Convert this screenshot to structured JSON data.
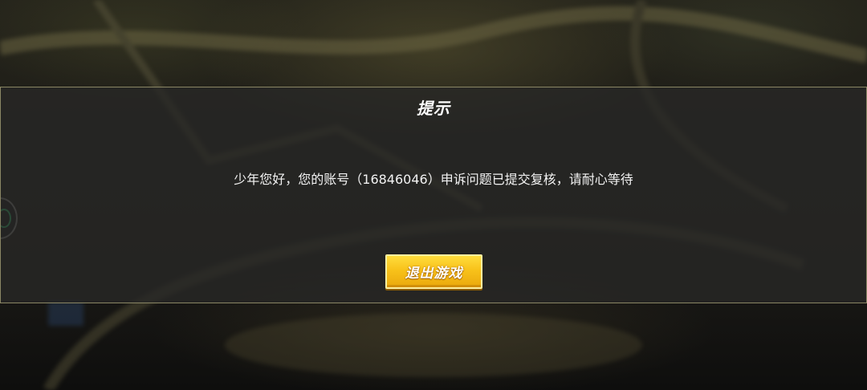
{
  "dialog": {
    "title": "提示",
    "message": "少年您好，您的账号（16846046）申诉问题已提交复核，请耐心等待",
    "exit_button_label": "退出游戏"
  },
  "colors": {
    "overlay": "#282826",
    "border": "#8a8664",
    "button_yellow": "#f8c21a",
    "badge_green": "#2fc070"
  },
  "icons": {
    "side_badge": "round-emblem-icon"
  }
}
